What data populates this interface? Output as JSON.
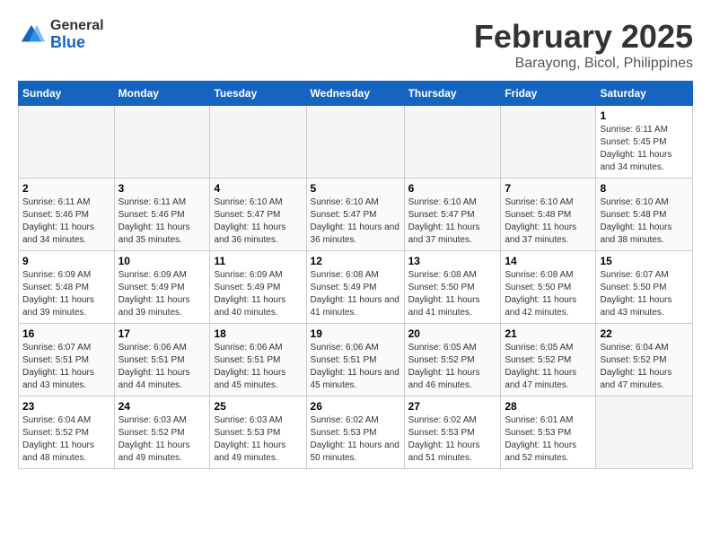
{
  "logo": {
    "general": "General",
    "blue": "Blue"
  },
  "title": "February 2025",
  "subtitle": "Barayong, Bicol, Philippines",
  "days_header": [
    "Sunday",
    "Monday",
    "Tuesday",
    "Wednesday",
    "Thursday",
    "Friday",
    "Saturday"
  ],
  "weeks": [
    [
      {
        "num": "",
        "info": ""
      },
      {
        "num": "",
        "info": ""
      },
      {
        "num": "",
        "info": ""
      },
      {
        "num": "",
        "info": ""
      },
      {
        "num": "",
        "info": ""
      },
      {
        "num": "",
        "info": ""
      },
      {
        "num": "1",
        "info": "Sunrise: 6:11 AM\nSunset: 5:45 PM\nDaylight: 11 hours\nand 34 minutes."
      }
    ],
    [
      {
        "num": "2",
        "info": "Sunrise: 6:11 AM\nSunset: 5:46 PM\nDaylight: 11 hours\nand 34 minutes."
      },
      {
        "num": "3",
        "info": "Sunrise: 6:11 AM\nSunset: 5:46 PM\nDaylight: 11 hours\nand 35 minutes."
      },
      {
        "num": "4",
        "info": "Sunrise: 6:10 AM\nSunset: 5:47 PM\nDaylight: 11 hours\nand 36 minutes."
      },
      {
        "num": "5",
        "info": "Sunrise: 6:10 AM\nSunset: 5:47 PM\nDaylight: 11 hours\nand 36 minutes."
      },
      {
        "num": "6",
        "info": "Sunrise: 6:10 AM\nSunset: 5:47 PM\nDaylight: 11 hours\nand 37 minutes."
      },
      {
        "num": "7",
        "info": "Sunrise: 6:10 AM\nSunset: 5:48 PM\nDaylight: 11 hours\nand 37 minutes."
      },
      {
        "num": "8",
        "info": "Sunrise: 6:10 AM\nSunset: 5:48 PM\nDaylight: 11 hours\nand 38 minutes."
      }
    ],
    [
      {
        "num": "9",
        "info": "Sunrise: 6:09 AM\nSunset: 5:48 PM\nDaylight: 11 hours\nand 39 minutes."
      },
      {
        "num": "10",
        "info": "Sunrise: 6:09 AM\nSunset: 5:49 PM\nDaylight: 11 hours\nand 39 minutes."
      },
      {
        "num": "11",
        "info": "Sunrise: 6:09 AM\nSunset: 5:49 PM\nDaylight: 11 hours\nand 40 minutes."
      },
      {
        "num": "12",
        "info": "Sunrise: 6:08 AM\nSunset: 5:49 PM\nDaylight: 11 hours\nand 41 minutes."
      },
      {
        "num": "13",
        "info": "Sunrise: 6:08 AM\nSunset: 5:50 PM\nDaylight: 11 hours\nand 41 minutes."
      },
      {
        "num": "14",
        "info": "Sunrise: 6:08 AM\nSunset: 5:50 PM\nDaylight: 11 hours\nand 42 minutes."
      },
      {
        "num": "15",
        "info": "Sunrise: 6:07 AM\nSunset: 5:50 PM\nDaylight: 11 hours\nand 43 minutes."
      }
    ],
    [
      {
        "num": "16",
        "info": "Sunrise: 6:07 AM\nSunset: 5:51 PM\nDaylight: 11 hours\nand 43 minutes."
      },
      {
        "num": "17",
        "info": "Sunrise: 6:06 AM\nSunset: 5:51 PM\nDaylight: 11 hours\nand 44 minutes."
      },
      {
        "num": "18",
        "info": "Sunrise: 6:06 AM\nSunset: 5:51 PM\nDaylight: 11 hours\nand 45 minutes."
      },
      {
        "num": "19",
        "info": "Sunrise: 6:06 AM\nSunset: 5:51 PM\nDaylight: 11 hours\nand 45 minutes."
      },
      {
        "num": "20",
        "info": "Sunrise: 6:05 AM\nSunset: 5:52 PM\nDaylight: 11 hours\nand 46 minutes."
      },
      {
        "num": "21",
        "info": "Sunrise: 6:05 AM\nSunset: 5:52 PM\nDaylight: 11 hours\nand 47 minutes."
      },
      {
        "num": "22",
        "info": "Sunrise: 6:04 AM\nSunset: 5:52 PM\nDaylight: 11 hours\nand 47 minutes."
      }
    ],
    [
      {
        "num": "23",
        "info": "Sunrise: 6:04 AM\nSunset: 5:52 PM\nDaylight: 11 hours\nand 48 minutes."
      },
      {
        "num": "24",
        "info": "Sunrise: 6:03 AM\nSunset: 5:52 PM\nDaylight: 11 hours\nand 49 minutes."
      },
      {
        "num": "25",
        "info": "Sunrise: 6:03 AM\nSunset: 5:53 PM\nDaylight: 11 hours\nand 49 minutes."
      },
      {
        "num": "26",
        "info": "Sunrise: 6:02 AM\nSunset: 5:53 PM\nDaylight: 11 hours\nand 50 minutes."
      },
      {
        "num": "27",
        "info": "Sunrise: 6:02 AM\nSunset: 5:53 PM\nDaylight: 11 hours\nand 51 minutes."
      },
      {
        "num": "28",
        "info": "Sunrise: 6:01 AM\nSunset: 5:53 PM\nDaylight: 11 hours\nand 52 minutes."
      },
      {
        "num": "",
        "info": ""
      }
    ]
  ]
}
